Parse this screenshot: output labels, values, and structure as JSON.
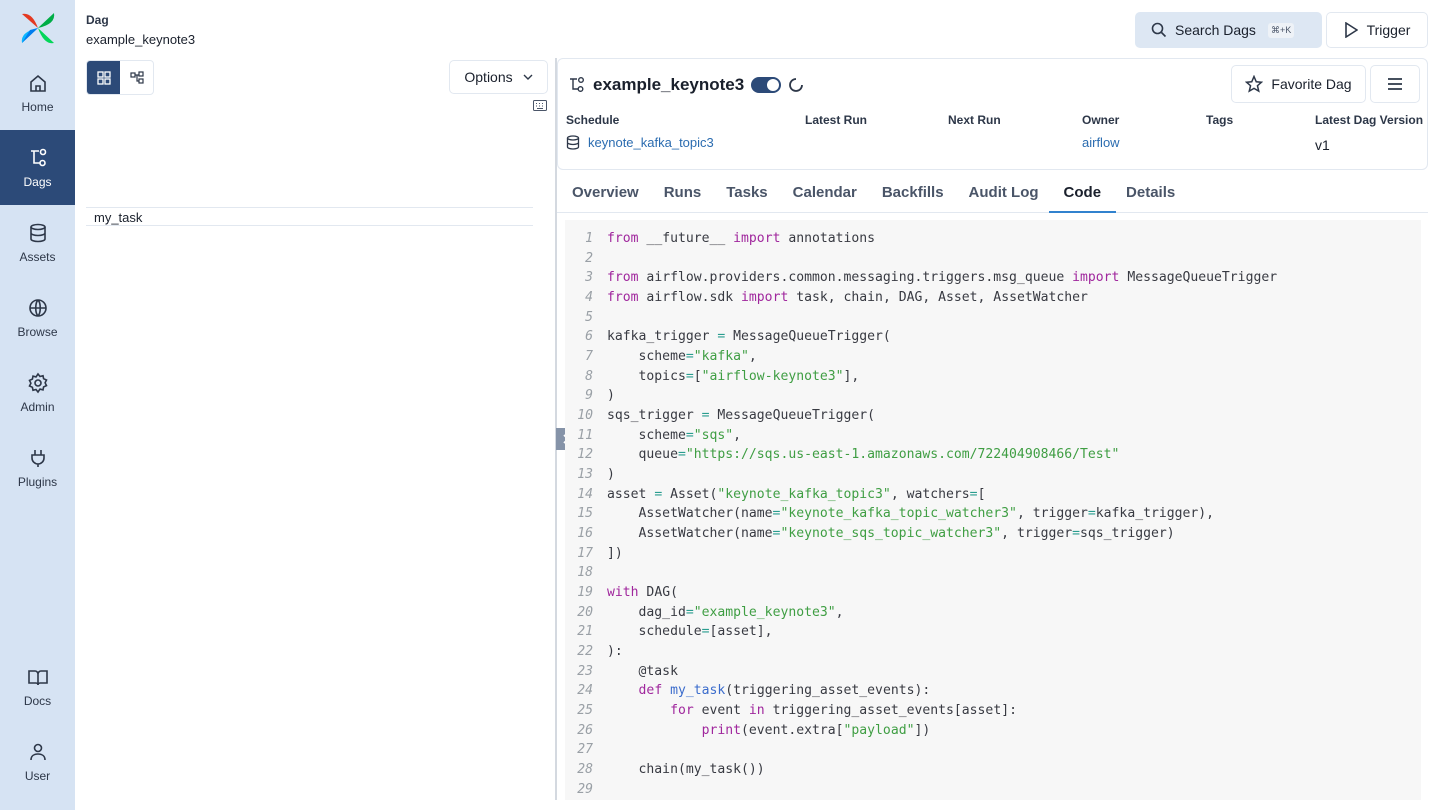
{
  "sidebar": {
    "items": [
      {
        "label": "Home",
        "icon": "home-icon"
      },
      {
        "label": "Dags",
        "icon": "dag-icon",
        "active": true
      },
      {
        "label": "Assets",
        "icon": "database-icon"
      },
      {
        "label": "Browse",
        "icon": "globe-icon"
      },
      {
        "label": "Admin",
        "icon": "gear-icon"
      },
      {
        "label": "Plugins",
        "icon": "plug-icon"
      },
      {
        "label": "Docs",
        "icon": "book-icon"
      },
      {
        "label": "User",
        "icon": "user-icon"
      }
    ]
  },
  "breadcrumb": {
    "label": "Dag",
    "value": "example_keynote3"
  },
  "left": {
    "options_label": "Options",
    "tasks": [
      "my_task"
    ]
  },
  "header": {
    "search_label": "Search Dags",
    "search_shortcut": "⌘+K",
    "trigger_label": "Trigger"
  },
  "dag": {
    "title": "example_keynote3",
    "favorite_label": "Favorite Dag",
    "enabled": true,
    "meta": {
      "schedule_label": "Schedule",
      "schedule_value": "keynote_kafka_topic3",
      "latest_run_label": "Latest Run",
      "next_run_label": "Next Run",
      "owner_label": "Owner",
      "owner_value": "airflow",
      "tags_label": "Tags",
      "version_label": "Latest Dag Version",
      "version_value": "v1"
    }
  },
  "tabs": [
    "Overview",
    "Runs",
    "Tasks",
    "Calendar",
    "Backfills",
    "Audit Log",
    "Code",
    "Details"
  ],
  "active_tab": "Code",
  "colors": {
    "accent": "#2c4a78",
    "sidebar": "#d6e3f3",
    "keyword": "#a0279d",
    "string": "#3f9e43"
  },
  "code": [
    [
      [
        "kw",
        "from"
      ],
      [
        "plain",
        " __future__ "
      ],
      [
        "kw",
        "import"
      ],
      [
        "plain",
        " annotations"
      ]
    ],
    [],
    [
      [
        "kw",
        "from"
      ],
      [
        "plain",
        " airflow.providers.common.messaging.triggers.msg_queue "
      ],
      [
        "kw",
        "import"
      ],
      [
        "plain",
        " MessageQueueTrigger"
      ]
    ],
    [
      [
        "kw",
        "from"
      ],
      [
        "plain",
        " airflow.sdk "
      ],
      [
        "kw",
        "import"
      ],
      [
        "plain",
        " task, chain, DAG, Asset, AssetWatcher"
      ]
    ],
    [],
    [
      [
        "plain",
        "kafka_trigger "
      ],
      [
        "op",
        "="
      ],
      [
        "plain",
        " MessageQueueTrigger("
      ]
    ],
    [
      [
        "plain",
        "    scheme"
      ],
      [
        "op",
        "="
      ],
      [
        "str",
        "\"kafka\""
      ],
      [
        "plain",
        ","
      ]
    ],
    [
      [
        "plain",
        "    topics"
      ],
      [
        "op",
        "="
      ],
      [
        "plain",
        "["
      ],
      [
        "str",
        "\"airflow-keynote3\""
      ],
      [
        "plain",
        "],"
      ]
    ],
    [
      [
        "plain",
        ")"
      ]
    ],
    [
      [
        "plain",
        "sqs_trigger "
      ],
      [
        "op",
        "="
      ],
      [
        "plain",
        " MessageQueueTrigger("
      ]
    ],
    [
      [
        "plain",
        "    scheme"
      ],
      [
        "op",
        "="
      ],
      [
        "str",
        "\"sqs\""
      ],
      [
        "plain",
        ","
      ]
    ],
    [
      [
        "plain",
        "    queue"
      ],
      [
        "op",
        "="
      ],
      [
        "str",
        "\"https://sqs.us-east-1.amazonaws.com/722404908466/Test\""
      ]
    ],
    [
      [
        "plain",
        ")"
      ]
    ],
    [
      [
        "plain",
        "asset "
      ],
      [
        "op",
        "="
      ],
      [
        "plain",
        " Asset("
      ],
      [
        "str",
        "\"keynote_kafka_topic3\""
      ],
      [
        "plain",
        ", watchers"
      ],
      [
        "op",
        "="
      ],
      [
        "plain",
        "["
      ]
    ],
    [
      [
        "plain",
        "    AssetWatcher(name"
      ],
      [
        "op",
        "="
      ],
      [
        "str",
        "\"keynote_kafka_topic_watcher3\""
      ],
      [
        "plain",
        ", trigger"
      ],
      [
        "op",
        "="
      ],
      [
        "plain",
        "kafka_trigger),"
      ]
    ],
    [
      [
        "plain",
        "    AssetWatcher(name"
      ],
      [
        "op",
        "="
      ],
      [
        "str",
        "\"keynote_sqs_topic_watcher3\""
      ],
      [
        "plain",
        ", trigger"
      ],
      [
        "op",
        "="
      ],
      [
        "plain",
        "sqs_trigger)"
      ]
    ],
    [
      [
        "plain",
        "])"
      ]
    ],
    [],
    [
      [
        "kw",
        "with"
      ],
      [
        "plain",
        " DAG("
      ]
    ],
    [
      [
        "plain",
        "    dag_id"
      ],
      [
        "op",
        "="
      ],
      [
        "str",
        "\"example_keynote3\""
      ],
      [
        "plain",
        ","
      ]
    ],
    [
      [
        "plain",
        "    schedule"
      ],
      [
        "op",
        "="
      ],
      [
        "plain",
        "[asset],"
      ]
    ],
    [
      [
        "plain",
        "):"
      ]
    ],
    [
      [
        "plain",
        "    @task"
      ]
    ],
    [
      [
        "plain",
        "    "
      ],
      [
        "kw",
        "def"
      ],
      [
        "plain",
        " "
      ],
      [
        "fn",
        "my_task"
      ],
      [
        "plain",
        "(triggering_asset_events):"
      ]
    ],
    [
      [
        "plain",
        "        "
      ],
      [
        "kw",
        "for"
      ],
      [
        "plain",
        " event "
      ],
      [
        "kw",
        "in"
      ],
      [
        "plain",
        " triggering_asset_events[asset]:"
      ]
    ],
    [
      [
        "plain",
        "            "
      ],
      [
        "kw",
        "print"
      ],
      [
        "plain",
        "(event.extra["
      ],
      [
        "str",
        "\"payload\""
      ],
      [
        "plain",
        "])"
      ]
    ],
    [],
    [
      [
        "plain",
        "    chain(my_task())"
      ]
    ],
    []
  ]
}
